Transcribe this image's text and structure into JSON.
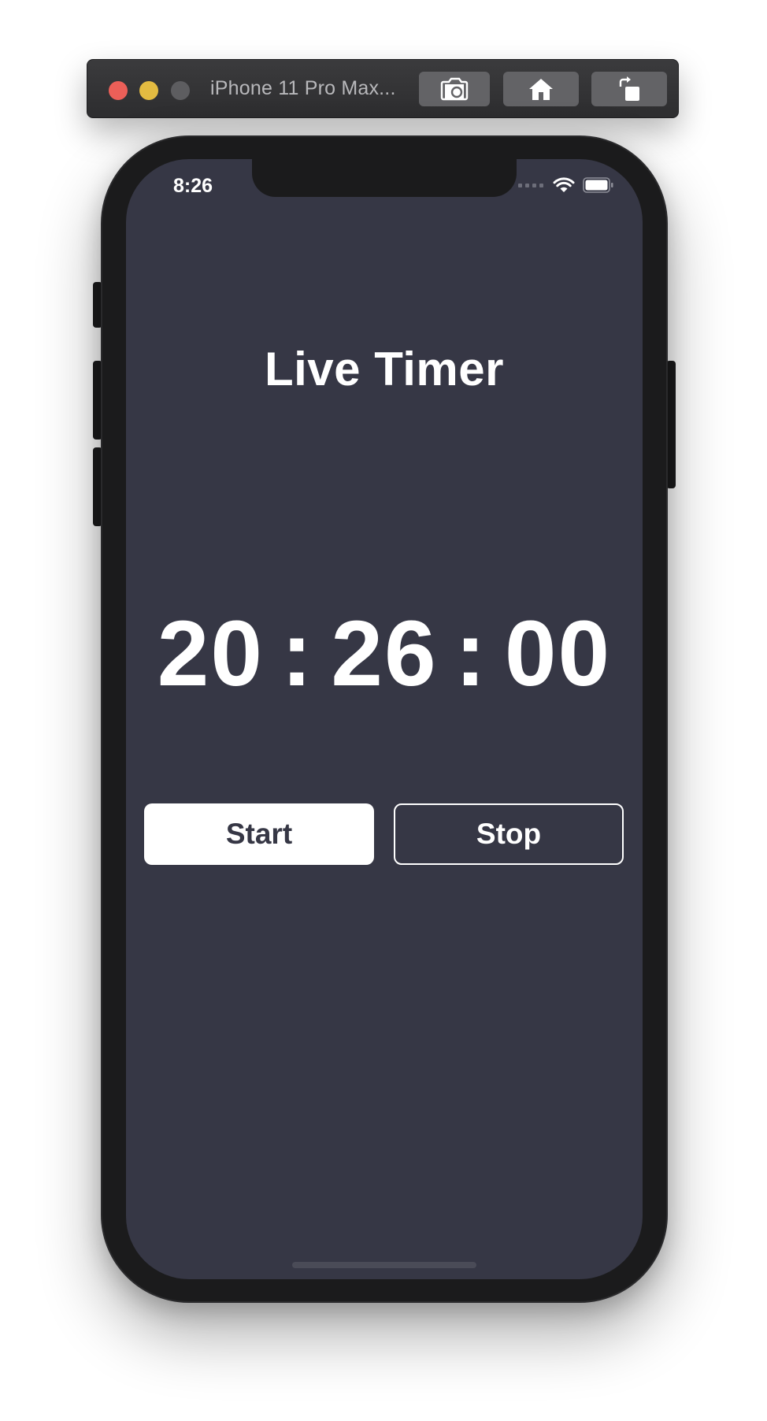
{
  "simulator": {
    "title": "iPhone 11 Pro Max...",
    "toolbar": [
      "camera-icon",
      "home-icon",
      "rotate-icon"
    ],
    "traffic_lights": {
      "close": "#ec5f58",
      "minimize": "#e3bb41",
      "zoom": "#5d5d60"
    }
  },
  "status_bar": {
    "time": "8:26",
    "icons": [
      "signal-icon",
      "wifi-icon",
      "battery-icon"
    ]
  },
  "app": {
    "title": "Live Timer",
    "timer": {
      "hours": "20",
      "minutes": "26",
      "seconds": "00",
      "separator": ":"
    },
    "buttons": {
      "start": "Start",
      "stop": "Stop"
    },
    "colors": {
      "background": "#363745",
      "text": "#ffffff"
    }
  }
}
